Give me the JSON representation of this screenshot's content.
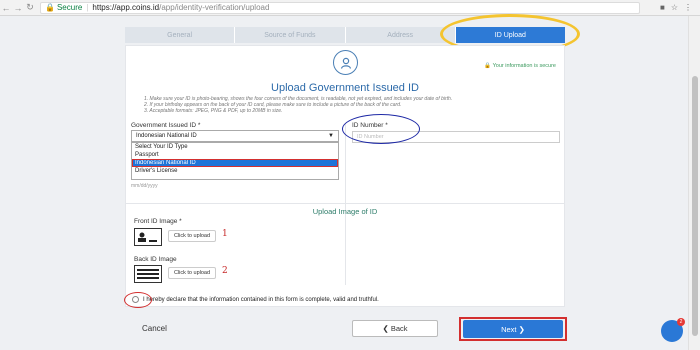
{
  "browser": {
    "secure_label": "Secure",
    "url_host": "https://app.coins.id",
    "url_path": "/app/identity-verification/upload"
  },
  "stepper": {
    "steps": [
      "General",
      "Source of Funds",
      "Address",
      "ID Upload"
    ],
    "active_index": 3
  },
  "card": {
    "secure_note": "Your information is secure",
    "title": "Upload Government Issued ID",
    "instructions": [
      "1. Make sure your ID is photo-bearing, shows the four corners of the document, is readable, not yet expired, and includes your date of birth.",
      "2. If your birthday appears on the back of your ID card, please make sure to include a picture of the back of the card.",
      "3. Acceptable formats: JPEG, PNG & PDF, up to 20MB in size."
    ],
    "id_type_label": "Government Issued ID *",
    "id_type_selected": "Indonesian National ID",
    "id_type_options": [
      "Select Your ID Type",
      "Passport",
      "Indonesian National ID",
      "Driver's License"
    ],
    "dob_hint": "mm/dd/yyyy",
    "id_number_label": "ID Number *",
    "id_number_placeholder": "ID Number",
    "section_title": "Upload Image of ID",
    "front_label": "Front ID Image *",
    "back_label": "Back ID Image",
    "upload_button": "Click to upload",
    "annotation_1": "1",
    "annotation_2": "2",
    "declaration": "I hereby declare that the information contained in this form is complete, valid and truthful."
  },
  "footer": {
    "cancel": "Cancel",
    "back": "Back",
    "next": "Next"
  },
  "chat": {
    "badge_count": "2"
  },
  "colors": {
    "accent": "#2a78d6",
    "highlight_yellow": "#f4c430",
    "annotation_red": "#d32f2f",
    "annotation_blue": "#1f2aa6"
  }
}
